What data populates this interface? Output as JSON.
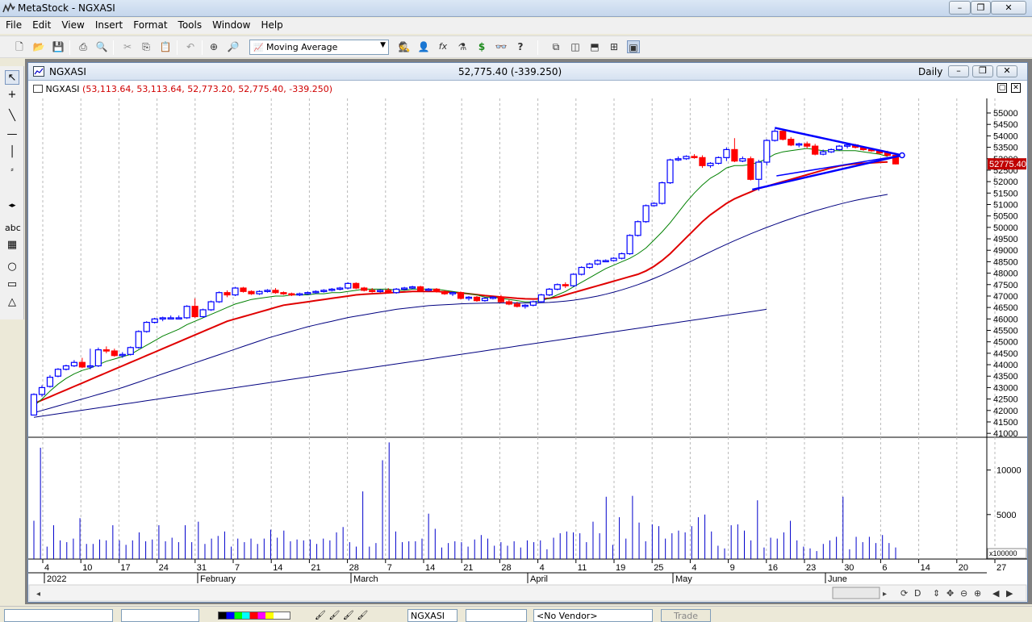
{
  "window": {
    "title": "MetaStock - NGXASI"
  },
  "menu": [
    "File",
    "Edit",
    "View",
    "Insert",
    "Format",
    "Tools",
    "Window",
    "Help"
  ],
  "toolbar": {
    "indicator_label": "Moving Average",
    "dollar_icon": "$",
    "help_icon": "?",
    "fx_icon": "fx"
  },
  "chart_window": {
    "symbol": "NGXASI",
    "last_price": "52,775.40 (-339.250)",
    "periodicity": "Daily"
  },
  "legend": {
    "symbol": "NGXASI",
    "values": "(53,113.64, 53,113.64, 52,773.20, 52,775.40, -339.250)"
  },
  "left_tools": {
    "text_tool": "abc"
  },
  "price_tag": "52775.40",
  "volume_multiplier": "x100000",
  "statusbar": {
    "security": "NGXASI",
    "vendor": "<No Vendor>",
    "trade": "Trade"
  },
  "colors": {
    "up_candle": "#0000ff",
    "down_candle": "#ff0000",
    "ma_fast": "#008000",
    "ma_mid": "#e00000",
    "ma_slow": "#000080",
    "trendline": "#0000ff"
  },
  "chart_data": {
    "type": "candlestick",
    "price_axis": {
      "min": 41000,
      "max": 55000,
      "step": 500,
      "label_step": 500
    },
    "volume_axis": {
      "ticks": [
        5000,
        10000
      ]
    },
    "x_tick_labels": [
      "4",
      "10",
      "17",
      "24",
      "31",
      "7",
      "14",
      "21",
      "28",
      "7",
      "14",
      "21",
      "28",
      "4",
      "11",
      "19",
      "25",
      "4",
      "9",
      "16",
      "23",
      "30",
      "6",
      "14",
      "20",
      "27"
    ],
    "month_labels": [
      "2022",
      "February",
      "March",
      "April",
      "May",
      "June"
    ],
    "ohlc": [
      [
        41800,
        42750,
        41800,
        42700
      ],
      [
        42700,
        43100,
        42600,
        43000
      ],
      [
        43050,
        43550,
        43000,
        43450
      ],
      [
        43500,
        43850,
        43450,
        43800
      ],
      [
        43800,
        44000,
        43750,
        43950
      ],
      [
        43950,
        44200,
        43900,
        44100
      ],
      [
        44100,
        44300,
        43850,
        43900
      ],
      [
        43900,
        44700,
        43800,
        43950
      ],
      [
        43950,
        44750,
        43900,
        44650
      ],
      [
        44650,
        44800,
        44500,
        44600
      ],
      [
        44600,
        44700,
        44350,
        44400
      ],
      [
        44400,
        44550,
        44300,
        44450
      ],
      [
        44450,
        44800,
        44400,
        44750
      ],
      [
        44750,
        45500,
        44700,
        45450
      ],
      [
        45450,
        45900,
        45400,
        45850
      ],
      [
        45850,
        46050,
        45800,
        46000
      ],
      [
        46000,
        46100,
        45900,
        46050
      ],
      [
        46050,
        46150,
        46000,
        46050
      ],
      [
        46050,
        46150,
        46000,
        46050
      ],
      [
        46050,
        46600,
        46000,
        46550
      ],
      [
        46550,
        46900,
        46050,
        46100
      ],
      [
        46100,
        46450,
        46050,
        46400
      ],
      [
        46400,
        46800,
        46350,
        46750
      ],
      [
        46750,
        47200,
        46700,
        47150
      ],
      [
        47150,
        47250,
        46950,
        47050
      ],
      [
        47050,
        47400,
        47000,
        47350
      ],
      [
        47350,
        47400,
        47150,
        47200
      ],
      [
        47200,
        47250,
        47050,
        47100
      ],
      [
        47100,
        47250,
        47050,
        47200
      ],
      [
        47200,
        47300,
        47150,
        47250
      ],
      [
        47250,
        47350,
        47100,
        47150
      ],
      [
        47150,
        47200,
        47050,
        47100
      ],
      [
        47100,
        47150,
        47000,
        47050
      ],
      [
        47050,
        47150,
        47000,
        47100
      ],
      [
        47100,
        47200,
        47050,
        47150
      ],
      [
        47150,
        47250,
        47100,
        47200
      ],
      [
        47200,
        47300,
        47150,
        47250
      ],
      [
        47250,
        47350,
        47200,
        47300
      ],
      [
        47300,
        47400,
        47250,
        47350
      ],
      [
        47350,
        47600,
        47300,
        47550
      ],
      [
        47550,
        47600,
        47300,
        47350
      ],
      [
        47350,
        47400,
        47200,
        47250
      ],
      [
        47250,
        47350,
        47150,
        47200
      ],
      [
        47200,
        47300,
        47150,
        47250
      ],
      [
        47250,
        47350,
        47100,
        47150
      ],
      [
        47150,
        47350,
        47100,
        47300
      ],
      [
        47300,
        47400,
        47250,
        47350
      ],
      [
        47350,
        47450,
        47300,
        47400
      ],
      [
        47400,
        47450,
        47200,
        47250
      ],
      [
        47250,
        47350,
        47200,
        47300
      ],
      [
        47300,
        47350,
        47150,
        47200
      ],
      [
        47200,
        47250,
        47050,
        47100
      ],
      [
        47100,
        47200,
        47000,
        47150
      ],
      [
        47150,
        47200,
        46850,
        46900
      ],
      [
        46900,
        47000,
        46800,
        46950
      ],
      [
        46950,
        47000,
        46750,
        46800
      ],
      [
        46800,
        46950,
        46750,
        46900
      ],
      [
        46900,
        47000,
        46850,
        46950
      ],
      [
        46950,
        47050,
        46700,
        46750
      ],
      [
        46750,
        46850,
        46600,
        46650
      ],
      [
        46650,
        46750,
        46500,
        46550
      ],
      [
        46550,
        46650,
        46450,
        46600
      ],
      [
        46600,
        46800,
        46550,
        46750
      ],
      [
        46750,
        47100,
        46700,
        47050
      ],
      [
        47050,
        47350,
        47000,
        47300
      ],
      [
        47300,
        47550,
        47250,
        47500
      ],
      [
        47500,
        47600,
        47350,
        47450
      ],
      [
        47450,
        48000,
        47400,
        47950
      ],
      [
        47950,
        48300,
        47900,
        48250
      ],
      [
        48250,
        48450,
        48200,
        48400
      ],
      [
        48400,
        48600,
        48350,
        48550
      ],
      [
        48550,
        48600,
        48500,
        48550
      ],
      [
        48550,
        48700,
        48500,
        48650
      ],
      [
        48650,
        48900,
        48600,
        48850
      ],
      [
        48850,
        49700,
        48800,
        49650
      ],
      [
        49650,
        50300,
        49600,
        50250
      ],
      [
        50250,
        51000,
        50200,
        50950
      ],
      [
        50950,
        51100,
        50900,
        51050
      ],
      [
        51050,
        52000,
        51000,
        51950
      ],
      [
        51950,
        53000,
        51900,
        52950
      ],
      [
        52950,
        53100,
        52900,
        53000
      ],
      [
        53000,
        53150,
        52950,
        53100
      ],
      [
        53100,
        53200,
        53000,
        53050
      ],
      [
        53050,
        53150,
        52600,
        52700
      ],
      [
        52700,
        52850,
        52600,
        52800
      ],
      [
        52800,
        53100,
        52750,
        53050
      ],
      [
        53050,
        53500,
        52900,
        53400
      ],
      [
        53400,
        53900,
        52850,
        52900
      ],
      [
        52900,
        53100,
        52850,
        53000
      ],
      [
        53000,
        53100,
        52050,
        52100
      ],
      [
        52100,
        52950,
        51600,
        52850
      ],
      [
        52850,
        53850,
        52700,
        53800
      ],
      [
        53800,
        54300,
        53750,
        54200
      ],
      [
        54200,
        54300,
        53800,
        53850
      ],
      [
        53850,
        53950,
        53550,
        53600
      ],
      [
        53600,
        53700,
        53500,
        53650
      ],
      [
        53650,
        53750,
        53450,
        53550
      ],
      [
        53550,
        53650,
        53150,
        53200
      ],
      [
        53200,
        53400,
        53150,
        53300
      ],
      [
        53300,
        53450,
        53250,
        53400
      ],
      [
        53400,
        53600,
        53350,
        53550
      ],
      [
        53550,
        53650,
        53450,
        53600
      ],
      [
        53600,
        53650,
        53450,
        53500
      ],
      [
        53500,
        53550,
        53350,
        53400
      ],
      [
        53400,
        53450,
        53300,
        53350
      ],
      [
        53350,
        53400,
        53200,
        53250
      ],
      [
        53250,
        53350,
        53100,
        53150
      ],
      [
        53150,
        53200,
        52750,
        52775
      ]
    ],
    "volume": [
      4300,
      12500,
      1400,
      3800,
      2100,
      1900,
      2300,
      4600,
      1700,
      1700,
      2200,
      2100,
      3800,
      2100,
      1600,
      2100,
      3000,
      2000,
      2200,
      3800,
      2000,
      2400,
      1900,
      3800,
      1900,
      4200,
      1700,
      2300,
      2600,
      3100,
      1400,
      2300,
      1900,
      2300,
      1700,
      2300,
      3300,
      2400,
      3200,
      2000,
      2200,
      2100,
      2200,
      1700,
      2300,
      2100,
      3000,
      3600,
      1900,
      1400,
      7600,
      1400,
      1800,
      11100,
      13100,
      3100,
      1900,
      2000,
      2000,
      2300,
      5100,
      3400,
      1300,
      1800,
      2000,
      1900,
      1400,
      2200,
      2700,
      2300,
      1500,
      1900,
      1500,
      2000,
      1300,
      2100,
      1900,
      2100,
      1100,
      2400,
      2900,
      3100,
      3000,
      2900,
      1900,
      4200,
      2900,
      7000,
      1600,
      4700,
      2300,
      7100,
      4100,
      2000,
      3900,
      3700,
      2300,
      2900,
      3200,
      3000,
      3700,
      4700,
      5000,
      3100,
      1500,
      1200,
      3800,
      3900,
      3200,
      2100,
      6600,
      1300,
      2400,
      2300,
      3000,
      4300,
      2100,
      1400,
      1200,
      900,
      1700,
      2100,
      2500,
      7000,
      1100,
      2500,
      1900,
      2500,
      1800,
      2700,
      1800,
      1300
    ],
    "ma_fast": [
      42200,
      42500,
      42850,
      43150,
      43400,
      43600,
      43750,
      43850,
      44000,
      44150,
      44250,
      44350,
      44450,
      44650,
      44850,
      45050,
      45250,
      45400,
      45550,
      45750,
      45900,
      46050,
      46200,
      46350,
      46500,
      46650,
      46750,
      46850,
      46900,
      46950,
      47000,
      47000,
      47050,
      47050,
      47050,
      47100,
      47100,
      47150,
      47150,
      47200,
      47250,
      47300,
      47300,
      47300,
      47300,
      47250,
      47250,
      47300,
      47300,
      47300,
      47300,
      47250,
      47200,
      47150,
      47100,
      47050,
      46950,
      46950,
      46900,
      46850,
      46800,
      46750,
      46750,
      46800,
      46900,
      47050,
      47200,
      47400,
      47600,
      47800,
      48000,
      48200,
      48350,
      48500,
      48650,
      48850,
      49100,
      49450,
      49800,
      50200,
      50650,
      51100,
      51500,
      51850,
      52150,
      52350,
      52600,
      52700,
      52700,
      52750,
      52850,
      53000,
      53200,
      53300,
      53350,
      53400,
      53450,
      53400,
      53350,
      53350,
      53350,
      53350,
      53350,
      53300,
      53250,
      53200,
      53100
    ],
    "ma_mid": [
      42300,
      42450,
      42600,
      42750,
      42900,
      43050,
      43200,
      43350,
      43500,
      43650,
      43800,
      43950,
      44100,
      44250,
      44400,
      44550,
      44700,
      44850,
      45000,
      45150,
      45300,
      45450,
      45600,
      45750,
      45900,
      46000,
      46100,
      46200,
      46300,
      46400,
      46500,
      46600,
      46650,
      46700,
      46750,
      46800,
      46850,
      46900,
      46950,
      47000,
      47050,
      47080,
      47100,
      47120,
      47140,
      47160,
      47180,
      47200,
      47200,
      47200,
      47200,
      47180,
      47160,
      47140,
      47100,
      47060,
      47020,
      46990,
      46960,
      46930,
      46900,
      46880,
      46870,
      46880,
      46900,
      46950,
      47050,
      47150,
      47250,
      47350,
      47450,
      47550,
      47650,
      47750,
      47850,
      47950,
      48100,
      48300,
      48550,
      48850,
      49200,
      49550,
      49900,
      50250,
      50550,
      50800,
      51050,
      51250,
      51400,
      51550,
      51700,
      51800,
      51900,
      52000,
      52100,
      52200,
      52300,
      52400,
      52500,
      52600,
      52680,
      52740,
      52780,
      52800,
      52820,
      52840,
      52860
    ],
    "ma_slow": [
      41900,
      42000,
      42100,
      42200,
      42300,
      42400,
      42500,
      42600,
      42700,
      42800,
      42900,
      43000,
      43120,
      43240,
      43360,
      43480,
      43600,
      43720,
      43840,
      43960,
      44080,
      44200,
      44320,
      44440,
      44560,
      44680,
      44800,
      44920,
      45040,
      45160,
      45260,
      45360,
      45460,
      45560,
      45660,
      45740,
      45820,
      45900,
      45980,
      46060,
      46120,
      46180,
      46240,
      46300,
      46360,
      46420,
      46460,
      46500,
      46540,
      46580,
      46600,
      46620,
      46640,
      46660,
      46670,
      46680,
      46690,
      46700,
      46700,
      46700,
      46700,
      46700,
      46700,
      46710,
      46720,
      46750,
      46780,
      46820,
      46870,
      46930,
      47000,
      47080,
      47170,
      47270,
      47380,
      47500,
      47630,
      47770,
      47920,
      48080,
      48250,
      48420,
      48590,
      48760,
      48930,
      49100,
      49260,
      49420,
      49570,
      49720,
      49860,
      50000,
      50130,
      50260,
      50380,
      50500,
      50610,
      50720,
      50820,
      50920,
      51010,
      51100,
      51180,
      51250,
      51320,
      51380,
      51440
    ],
    "ma_long": [
      41700,
      41780,
      41860,
      41940,
      42020,
      42100,
      42180,
      42260,
      42340,
      42420,
      42500,
      42580,
      42660,
      42740,
      42820,
      42900,
      42980,
      43060,
      43140,
      43220,
      43300,
      43380,
      43460,
      43540,
      43620,
      43700,
      43780,
      43860,
      43940,
      44020,
      44100,
      44180,
      44260,
      44340,
      44420,
      44500,
      44580,
      44660,
      44740,
      44820,
      44900,
      44980,
      45060,
      45140,
      45220,
      45300,
      45380,
      45460,
      45540,
      45620,
      45700,
      45780,
      45860,
      45940,
      46020,
      46100,
      46180,
      46260,
      46340,
      46420
    ]
  }
}
